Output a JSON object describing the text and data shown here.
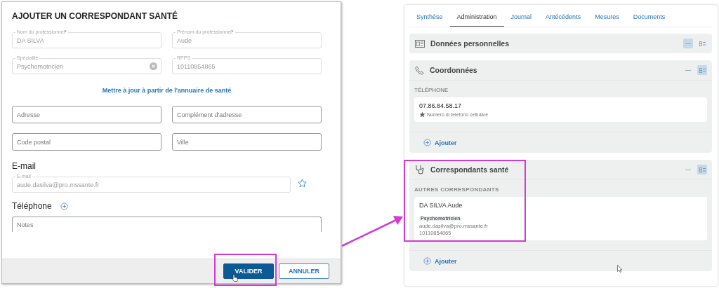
{
  "dialog": {
    "title": "AJOUTER UN CORRESPONDANT SANTÉ",
    "identity_fields": [
      {
        "label": "Nom du professionnel",
        "value": "DA SILVA",
        "required_mark": "*",
        "kind": "text"
      },
      {
        "label": "Prénom du professionnel",
        "value": "Aude",
        "required_mark": "*",
        "kind": "text"
      },
      {
        "label": "Spécialité",
        "value": "Psychomotricien",
        "kind": "select"
      },
      {
        "label": "RPPS",
        "value": "10110854865",
        "kind": "text"
      }
    ],
    "update_link": "Mettre à jour à partir de l'annuaire de santé",
    "address_fields": [
      {
        "placeholder": "Adresse"
      },
      {
        "placeholder": "Complément d'adresse"
      },
      {
        "placeholder": "Code postal"
      },
      {
        "placeholder": "Ville"
      }
    ],
    "email_heading": "E-mail",
    "email_field": {
      "label": "E-mail",
      "value": "aude.dasilva@pro.mssante.fr",
      "favorite": false
    },
    "phone_heading": "Téléphone",
    "notes": {
      "placeholder": "Notes"
    },
    "buttons": [
      {
        "label": "VALIDER",
        "kind": "primary"
      },
      {
        "label": "ANNULER",
        "kind": "secondary"
      }
    ]
  },
  "record": {
    "tabs": [
      {
        "label": "Synthèse",
        "selected": false
      },
      {
        "label": "Administration",
        "selected": true
      },
      {
        "label": "Journal",
        "selected": false
      },
      {
        "label": "Antécédents",
        "selected": false
      },
      {
        "label": "Mesures",
        "selected": false
      },
      {
        "label": "Documents",
        "selected": false
      }
    ],
    "sections": [
      {
        "title": "Données personnelles",
        "collapsed": true
      },
      {
        "title": "Coordonnées",
        "collapsed": false,
        "group_label": "TÉLÉPHONE",
        "cards": [
          {
            "kind": "phone",
            "number": "07.86.84.58.17",
            "note": "Numero di telefono cellulare"
          }
        ],
        "add_label": "Ajouter"
      },
      {
        "title": "Correspondants santé",
        "collapsed": false,
        "group_label": "AUTRES CORRESPONDANTS",
        "cards": [
          {
            "kind": "correspondent",
            "name": "DA SILVA Aude",
            "specialty": "Psychomotricien",
            "email": "aude.dasilva@pro.mssante.fr",
            "rpps": "10110854865"
          }
        ],
        "add_label": "Ajouter"
      }
    ]
  }
}
